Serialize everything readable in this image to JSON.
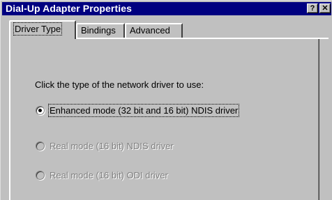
{
  "window": {
    "title": "Dial-Up Adapter Properties",
    "help_label": "?",
    "close_label": "✕"
  },
  "tabs": [
    {
      "label": "Driver Type"
    },
    {
      "label": "Bindings"
    },
    {
      "label": "Advanced"
    }
  ],
  "panel": {
    "instruction": "Click the type of the network driver to use:",
    "options": [
      {
        "label": "Enhanced mode (32 bit and 16 bit) NDIS driver",
        "selected": true,
        "enabled": true
      },
      {
        "label": "Real mode (16 bit) NDIS driver",
        "selected": false,
        "enabled": false
      },
      {
        "label": "Real mode (16 bit) ODI driver",
        "selected": false,
        "enabled": false
      }
    ]
  }
}
